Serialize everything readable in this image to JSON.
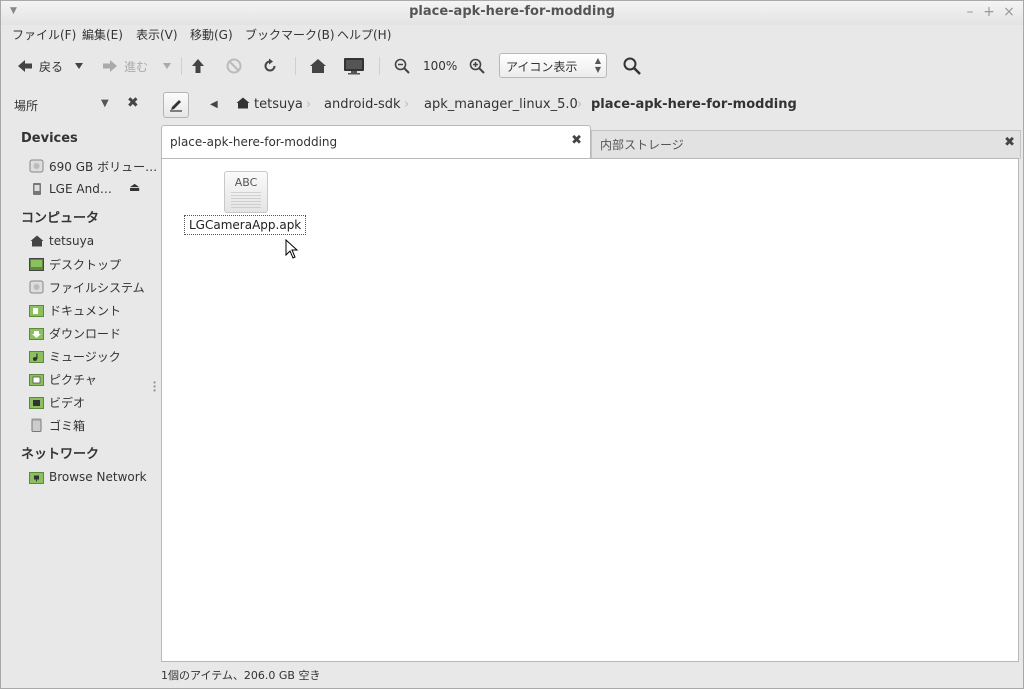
{
  "window": {
    "title": "place-apk-here-for-modding"
  },
  "menubar": [
    {
      "label": "ファイル(F)"
    },
    {
      "label": "編集(E)"
    },
    {
      "label": "表示(V)"
    },
    {
      "label": "移動(G)"
    },
    {
      "label": "ブックマーク(B)"
    },
    {
      "label": "ヘルプ(H)"
    }
  ],
  "toolbar": {
    "back_label": "戻る",
    "forward_label": "進む",
    "zoom_level": "100%",
    "view_mode": "アイコン表示"
  },
  "sidebar": {
    "header": "場所",
    "devices_title": "Devices",
    "devices": [
      {
        "label": "690 GB ボリュー…",
        "icon": "drive-icon"
      },
      {
        "label": "LGE And…",
        "icon": "usb-device-icon"
      }
    ],
    "computer_title": "コンピュータ",
    "computer": [
      {
        "label": "tetsuya",
        "icon": "home-icon"
      },
      {
        "label": "デスクトップ",
        "icon": "desktop-icon"
      },
      {
        "label": "ファイルシステム",
        "icon": "filesystem-icon"
      },
      {
        "label": "ドキュメント",
        "icon": "documents-folder-icon"
      },
      {
        "label": "ダウンロード",
        "icon": "downloads-folder-icon"
      },
      {
        "label": "ミュージック",
        "icon": "music-folder-icon"
      },
      {
        "label": "ピクチャ",
        "icon": "pictures-folder-icon"
      },
      {
        "label": "ビデオ",
        "icon": "videos-folder-icon"
      },
      {
        "label": "ゴミ箱",
        "icon": "trash-icon"
      }
    ],
    "network_title": "ネットワーク",
    "network": [
      {
        "label": "Browse Network",
        "icon": "network-icon"
      }
    ]
  },
  "breadcrumbs": [
    {
      "label": "tetsuya"
    },
    {
      "label": "android-sdk"
    },
    {
      "label": "apk_manager_linux_5.0"
    },
    {
      "label": "place-apk-here-for-modding"
    }
  ],
  "tabs": [
    {
      "label": "place-apk-here-for-modding"
    },
    {
      "label": "内部ストレージ"
    }
  ],
  "files": [
    {
      "name": "LGCameraApp.apk",
      "icon_text": "ABC"
    }
  ],
  "status": {
    "text": "1個のアイテム、206.0 GB 空き"
  },
  "colors": {
    "window_bg": "#e8e8e8",
    "content_bg": "#ffffff",
    "text": "#333333"
  }
}
